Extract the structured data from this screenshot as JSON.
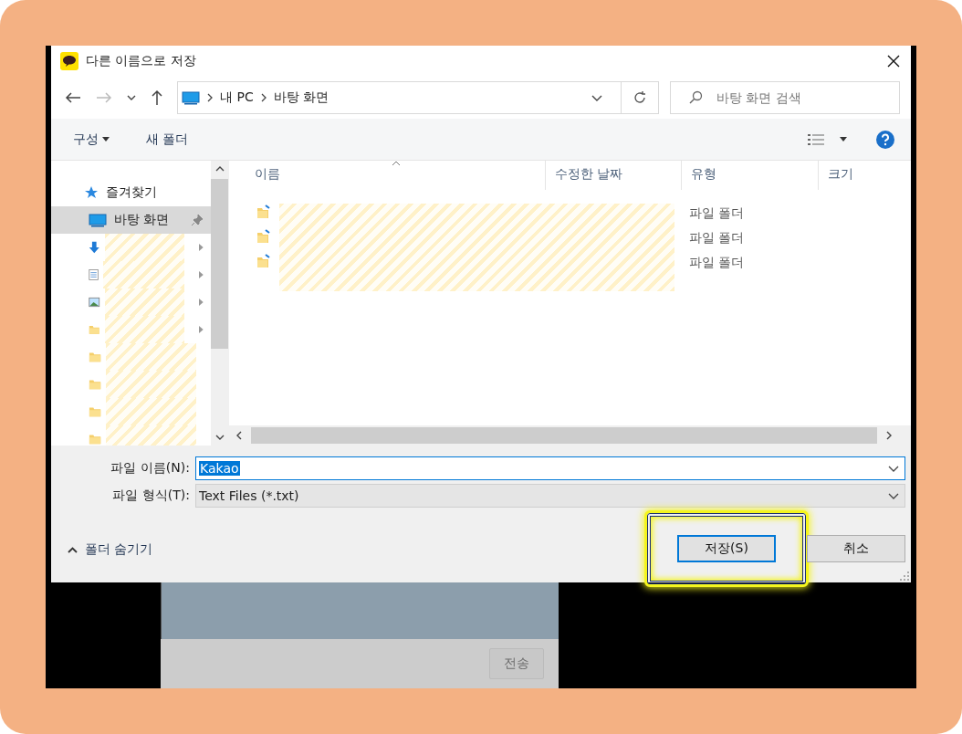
{
  "window": {
    "title": "다른 이름으로 저장"
  },
  "address": {
    "path": [
      "내 PC",
      "바탕 화면"
    ]
  },
  "search": {
    "placeholder": "바탕 화면 검색"
  },
  "toolbar": {
    "organize": "구성",
    "new_folder": "새 폴더"
  },
  "sidebar": {
    "items": [
      {
        "label": "즐겨찾기",
        "kind": "star",
        "selected": false,
        "pinned": false,
        "expandable": false
      },
      {
        "label": "바탕 화면",
        "kind": "desktop",
        "selected": true,
        "pinned": true,
        "expandable": false
      },
      {
        "kind": "download",
        "selected": false,
        "pinned": false,
        "expandable": true
      },
      {
        "kind": "document",
        "selected": false,
        "pinned": false,
        "expandable": true
      },
      {
        "kind": "image",
        "selected": false,
        "pinned": false,
        "expandable": true
      },
      {
        "kind": "folder",
        "selected": false,
        "pinned": false,
        "expandable": true
      },
      {
        "kind": "folder",
        "selected": false,
        "pinned": false,
        "expandable": false
      },
      {
        "kind": "folder",
        "selected": false,
        "pinned": false,
        "expandable": false
      },
      {
        "kind": "folder",
        "selected": false,
        "pinned": false,
        "expandable": false
      },
      {
        "kind": "folder",
        "selected": false,
        "pinned": false,
        "expandable": false
      }
    ]
  },
  "table": {
    "columns": [
      "이름",
      "수정한 날짜",
      "유형",
      "크기"
    ],
    "rows": [
      {
        "type": "파일 폴더"
      },
      {
        "type": "파일 폴더"
      },
      {
        "type": "파일 폴더"
      }
    ]
  },
  "filename": {
    "label": "파일 이름(N):",
    "value": "Kakao"
  },
  "filetype": {
    "label": "파일 형식(T):",
    "value": "Text Files (*.txt)"
  },
  "hide_folders": "폴더 숨기기",
  "buttons": [
    {
      "label": "저장(S)",
      "highlighted": true
    },
    {
      "label": "취소",
      "highlighted": false
    }
  ],
  "background_app": {
    "send_button": "전송"
  }
}
